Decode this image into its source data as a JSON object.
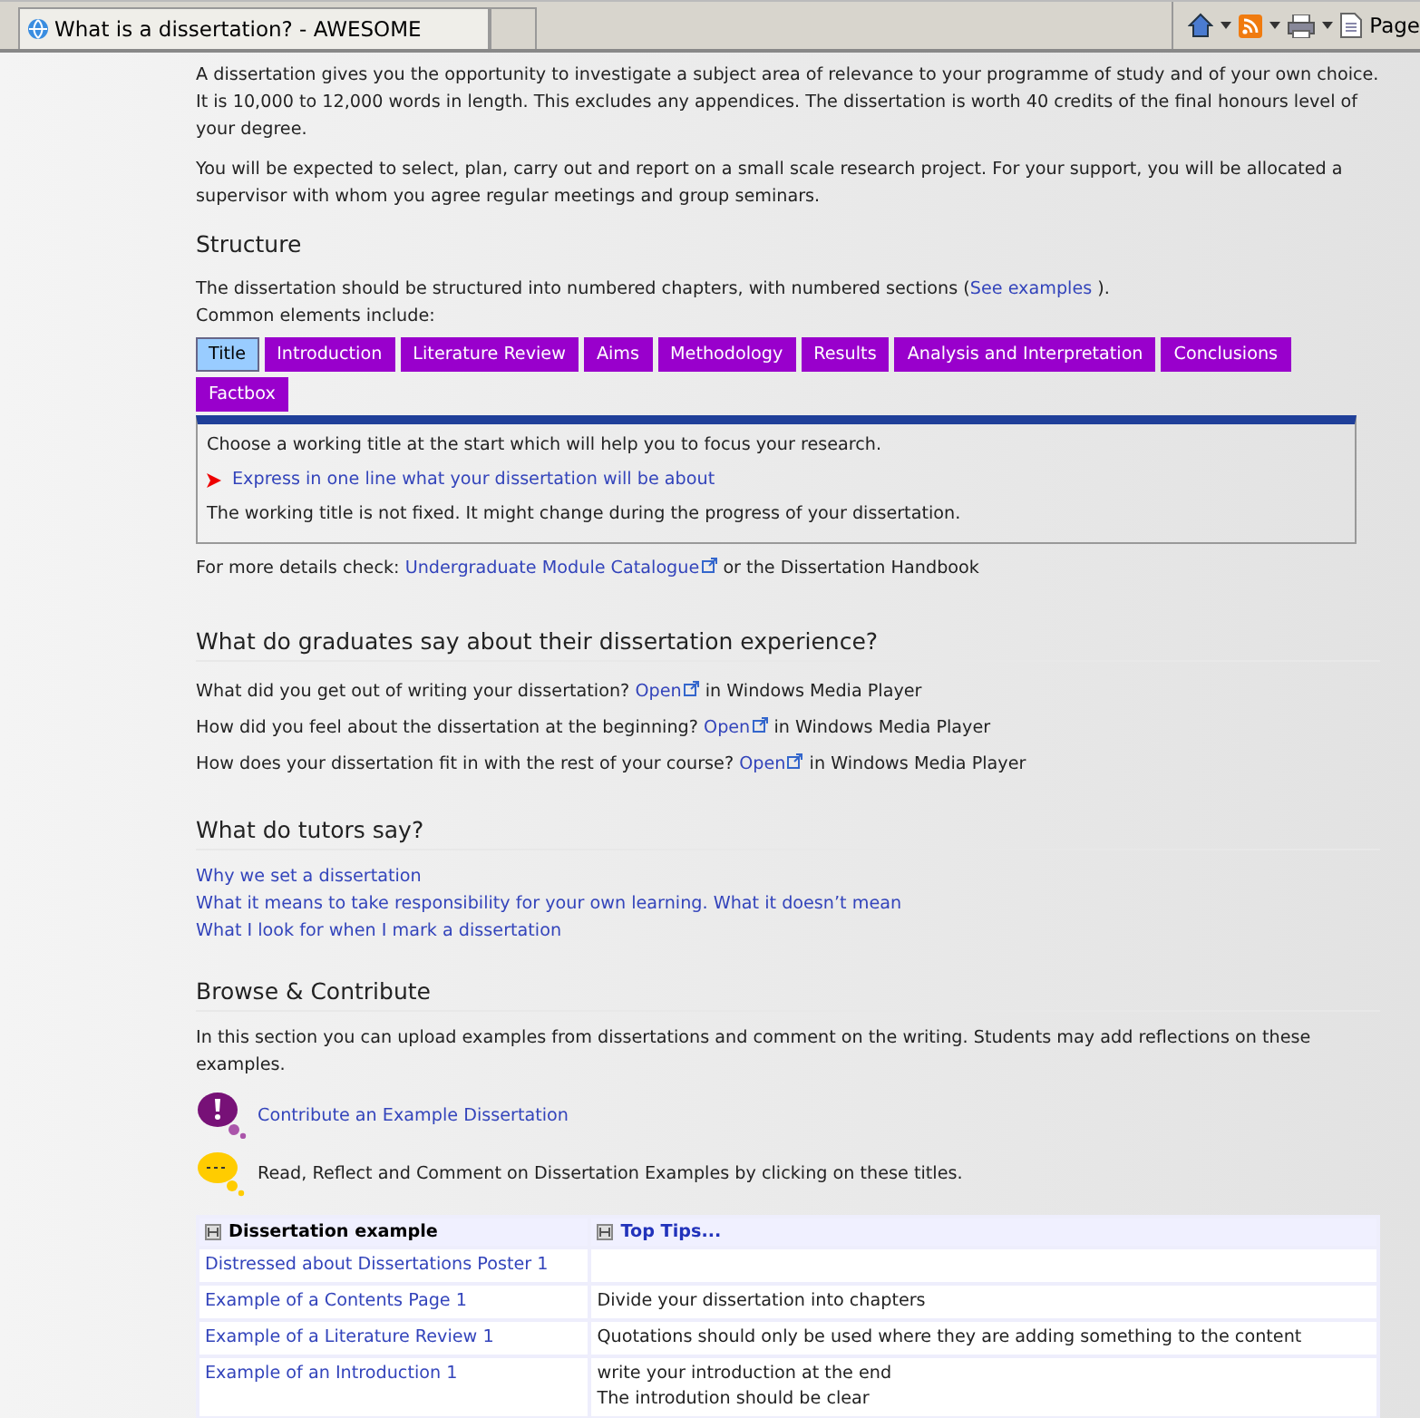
{
  "browser": {
    "tabs": [
      {
        "title": "What is a dissertation? - AWESOME",
        "selected": true
      },
      {
        "selected": false
      }
    ],
    "toolbar_label": "Page"
  },
  "intro": [
    "A dissertation gives you the opportunity to investigate a subject area of relevance to your programme of study and of your own choice. It is 10,000 to 12,000 words in length. This excludes any appendices. The dissertation is worth 40 credits of the final honours level of your degree.",
    "You will be expected to select, plan, carry out and report on a small scale research project. For your support, you will be allocated a supervisor with whom you agree regular meetings and group seminars."
  ],
  "structure": {
    "heading": "Structure",
    "text_before": "The dissertation should be structured into numbered chapters, with numbered sections (",
    "link": "See examples",
    "text_after": " ).",
    "line2": "Common elements include:",
    "tabs": [
      {
        "label": "Title",
        "selected": true
      },
      {
        "label": "Introduction",
        "selected": false
      },
      {
        "label": "Literature Review",
        "selected": false
      },
      {
        "label": "Aims",
        "selected": false
      },
      {
        "label": "Methodology",
        "selected": false
      },
      {
        "label": "Results",
        "selected": false
      },
      {
        "label": "Analysis and Interpretation",
        "selected": false
      },
      {
        "label": "Conclusions",
        "selected": false
      },
      {
        "label": "Factbox",
        "selected": false
      }
    ],
    "panel": [
      {
        "kind": "text",
        "text": "Choose a working title at the start which will help you to focus your research."
      },
      {
        "kind": "bullet",
        "text": "Express in one line what your dissertation will be about"
      },
      {
        "kind": "text",
        "text": "The working title is not fixed. It might change during the progress of your dissertation."
      }
    ],
    "more": {
      "prefix": "For more details check: ",
      "link": "Undergraduate Module Catalogue",
      "suffix": " or the Dissertation Handbook"
    }
  },
  "graduates": {
    "heading": "What do graduates say about their dissertation experience?",
    "items": [
      {
        "question": "What did you get out of writing your dissertation? ",
        "link": "Open",
        "suffix": " in Windows Media Player"
      },
      {
        "question": "How did you feel about the dissertation at the beginning? ",
        "link": "Open",
        "suffix": " in Windows Media Player"
      },
      {
        "question": "How does your dissertation fit in with the rest of your course? ",
        "link": "Open",
        "suffix": " in Windows Media Player"
      }
    ]
  },
  "tutors": {
    "heading": "What do tutors say?",
    "links": [
      "Why we set a dissertation",
      "What it means to take responsibility for your own learning. What it doesn’t mean",
      "What I look for when I mark a dissertation"
    ]
  },
  "browse": {
    "heading": "Browse & Contribute",
    "text": "In this section you can upload examples from dissertations and comment on the writing. Students may add reflections on these examples.",
    "actions": [
      {
        "kind": "link",
        "text": "Contribute an Example Dissertation"
      },
      {
        "kind": "text",
        "text": "Read, Reflect and Comment on Dissertation Examples by clicking on these titles."
      }
    ],
    "table": {
      "columns": [
        "Dissertation example",
        "Top Tips..."
      ],
      "rows": [
        {
          "example": "Distressed about Dissertations Poster 1",
          "tips": []
        },
        {
          "example": "Example of a Contents Page 1",
          "tips": [
            "Divide your dissertation into chapters"
          ]
        },
        {
          "example": "Example of a Literature Review 1",
          "tips": [
            "Quotations should only be used where they are adding something to the content"
          ]
        },
        {
          "example": "Example of an Introduction 1",
          "tips": [
            "write your introduction at the end",
            "The introdution should be clear"
          ]
        }
      ]
    }
  }
}
